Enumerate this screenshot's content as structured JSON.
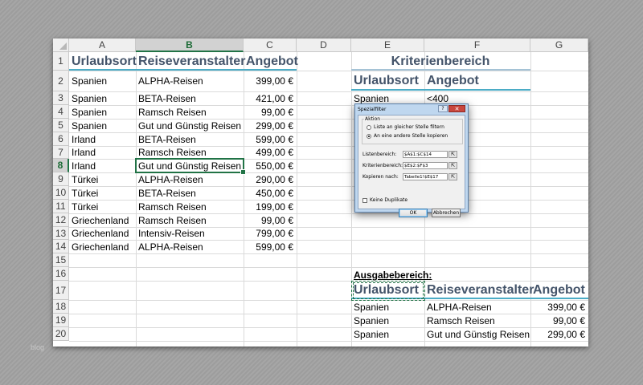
{
  "columns": [
    "A",
    "B",
    "C",
    "D",
    "E",
    "F",
    "G"
  ],
  "rows": [
    "1",
    "2",
    "3",
    "4",
    "5",
    "6",
    "7",
    "8",
    "9",
    "10",
    "11",
    "12",
    "13",
    "14",
    "15",
    "16",
    "17",
    "18",
    "19",
    "20"
  ],
  "selected_column": "B",
  "selected_row": "8",
  "main_table": {
    "headers": [
      "Urlaubsort",
      "Reiseveranstalter",
      "Angebot"
    ],
    "rows": [
      [
        "Spanien",
        "ALPHA-Reisen",
        "399,00 €"
      ],
      [
        "Spanien",
        "BETA-Reisen",
        "421,00 €"
      ],
      [
        "Spanien",
        "Ramsch Reisen",
        "99,00 €"
      ],
      [
        "Spanien",
        "Gut und Günstig Reisen",
        "299,00 €"
      ],
      [
        "Irland",
        "BETA-Reisen",
        "599,00 €"
      ],
      [
        "Irland",
        "Ramsch Reisen",
        "499,00 €"
      ],
      [
        "Irland",
        "Gut und Günstig Reisen",
        "550,00 €"
      ],
      [
        "Türkei",
        "ALPHA-Reisen",
        "290,00 €"
      ],
      [
        "Türkei",
        "BETA-Reisen",
        "450,00 €"
      ],
      [
        "Türkei",
        "Ramsch Reisen",
        "199,00 €"
      ],
      [
        "Griechenland",
        "Ramsch Reisen",
        "99,00 €"
      ],
      [
        "Griechenland",
        "Intensiv-Reisen",
        "799,00 €"
      ],
      [
        "Griechenland",
        "ALPHA-Reisen",
        "599,00 €"
      ]
    ]
  },
  "criteria": {
    "title": "Kriterienbereich",
    "headers": [
      "Urlaubsort",
      "Angebot"
    ],
    "values": [
      "Spanien",
      "<400"
    ]
  },
  "output": {
    "label": "Ausgabebereich:",
    "headers": [
      "Urlaubsort",
      "Reiseveranstalter",
      "Angebot"
    ],
    "rows": [
      [
        "Spanien",
        "ALPHA-Reisen",
        "399,00 €"
      ],
      [
        "Spanien",
        "Ramsch Reisen",
        "99,00 €"
      ],
      [
        "Spanien",
        "Gut und Günstig Reisen",
        "299,00 €"
      ]
    ]
  },
  "dialog": {
    "title": "Spezialfilter",
    "help": "?",
    "close": "✕",
    "action_legend": "Aktion",
    "radio_filter_in_place": "Liste an gleicher Stelle filtern",
    "radio_copy_to": "An eine andere Stelle kopieren",
    "list_range_label": "Listenbereich:",
    "list_range_value": "$A$1:$C$14",
    "criteria_range_label": "Kriterienbereich:",
    "criteria_range_value": "$E$2:$F$3",
    "copy_to_label": "Kopieren nach:",
    "copy_to_value": "Tabelle1!$E$17",
    "unique_label": "Keine Duplikate",
    "ok_label": "OK",
    "cancel_label": "Abbrechen"
  },
  "watermark": "blog",
  "colors": {
    "accent_green": "#217346",
    "header_text": "#44546a",
    "underline": "#4bacc6"
  }
}
